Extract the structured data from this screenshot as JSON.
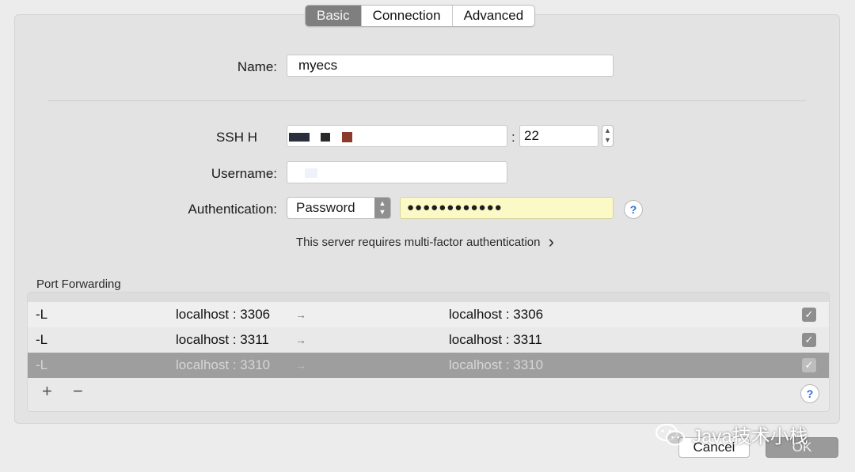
{
  "tabs": [
    "Basic",
    "Connection",
    "Advanced"
  ],
  "form": {
    "name_label": "Name:",
    "name_value": "myecs",
    "ssh_host_label": "SSH H",
    "port_separator": ":",
    "port_value": "22",
    "username_label": "Username:",
    "auth_label": "Authentication:",
    "auth_method": "Password",
    "password_mask": "●●●●●●●●●●●●",
    "help_icon_glyph": "?",
    "mfa_text": "This server requires multi-factor authentication",
    "mfa_chevron": "›"
  },
  "port_forwarding": {
    "title": "Port Forwarding",
    "rows": [
      {
        "type": "-L",
        "local_host": "localhost",
        "local_port": "3306",
        "arrow": "→",
        "remote_host": "localhost",
        "remote_port": "3306",
        "checked": true
      },
      {
        "type": "-L",
        "local_host": "localhost",
        "local_port": "3311",
        "arrow": "→",
        "remote_host": "localhost",
        "remote_port": "3311",
        "checked": true
      },
      {
        "type": "-L",
        "local_host": "localhost",
        "local_port": "3310",
        "arrow": "→",
        "remote_host": "localhost",
        "remote_port": "3310",
        "checked": true
      }
    ],
    "add_glyph": "+",
    "remove_glyph": "−"
  },
  "buttons": {
    "cancel": "Cancel",
    "ok": "OK"
  },
  "watermark": "Java技术小栈",
  "colors": {
    "selected_tab": "#7f7f7f",
    "selected_row": "#9e9e9f",
    "password_bg": "#fbf9c5",
    "help_blue": "#2b6fd6"
  }
}
